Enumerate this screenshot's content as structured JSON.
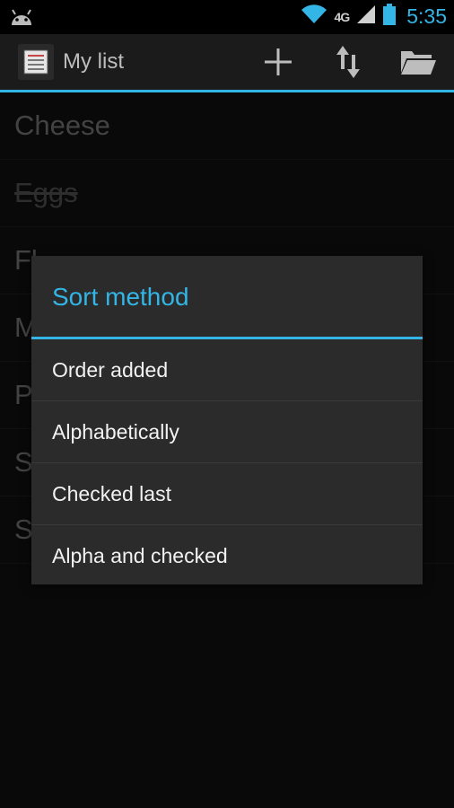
{
  "status_bar": {
    "network_label": "4G",
    "time": "5:35"
  },
  "action_bar": {
    "title": "My list",
    "add_icon": "plus-icon",
    "sort_icon": "sort-arrows-icon",
    "open_icon": "folder-icon"
  },
  "list": {
    "items": [
      {
        "label": "Cheese",
        "checked": false
      },
      {
        "label": "Eggs",
        "checked": true
      },
      {
        "label": "Fl",
        "checked": false
      },
      {
        "label": "M",
        "checked": false
      },
      {
        "label": "P",
        "checked": false
      },
      {
        "label": "S",
        "checked": false
      },
      {
        "label": "S",
        "checked": false
      }
    ]
  },
  "dialog": {
    "title": "Sort method",
    "options": [
      "Order added",
      "Alphabetically",
      "Checked last",
      "Alpha and checked"
    ]
  },
  "colors": {
    "accent": "#33b5e5",
    "background": "#111111",
    "dialog": "#2b2b2b"
  }
}
